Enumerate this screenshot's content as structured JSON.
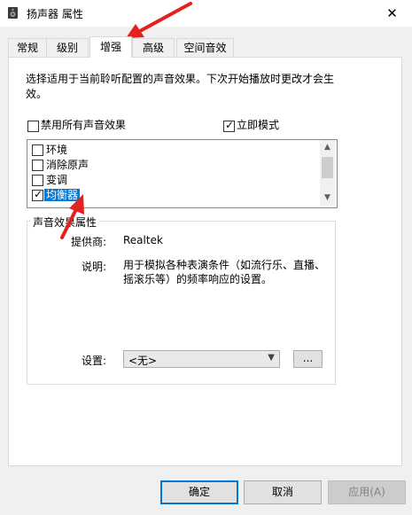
{
  "window": {
    "title": "扬声器 属性",
    "close_symbol": "✕"
  },
  "tabs": [
    {
      "label": "常规",
      "active": false
    },
    {
      "label": "级别",
      "active": false
    },
    {
      "label": "增强",
      "active": true
    },
    {
      "label": "高级",
      "active": false
    },
    {
      "label": "空间音效",
      "active": false
    }
  ],
  "description": "选择适用于当前聆听配置的声音效果。下次开始播放时更改才会生效。",
  "options": {
    "disable_all": {
      "label": "禁用所有声音效果",
      "checked": false
    },
    "immediate_mode": {
      "label": "立即模式",
      "checked": true
    }
  },
  "effects_list": [
    {
      "label": "环境",
      "checked": false,
      "selected": false
    },
    {
      "label": "消除原声",
      "checked": false,
      "selected": false
    },
    {
      "label": "变调",
      "checked": false,
      "selected": false
    },
    {
      "label": "均衡器",
      "checked": true,
      "selected": true
    }
  ],
  "properties": {
    "group_title": "声音效果属性",
    "provider_label": "提供商:",
    "provider_value": "Realtek",
    "desc_label": "说明:",
    "desc_line1": "用于模拟各种表演条件（如流行乐、直播、",
    "desc_line2": "摇滚乐等）的频率响应的设置。",
    "settings_label": "设置:",
    "settings_value": "<无>",
    "more_label": "..."
  },
  "buttons": {
    "ok": "确定",
    "cancel": "取消",
    "apply": "应用(A)"
  },
  "colors": {
    "accent": "#0078d7",
    "annotation_arrow": "#e3221f"
  }
}
